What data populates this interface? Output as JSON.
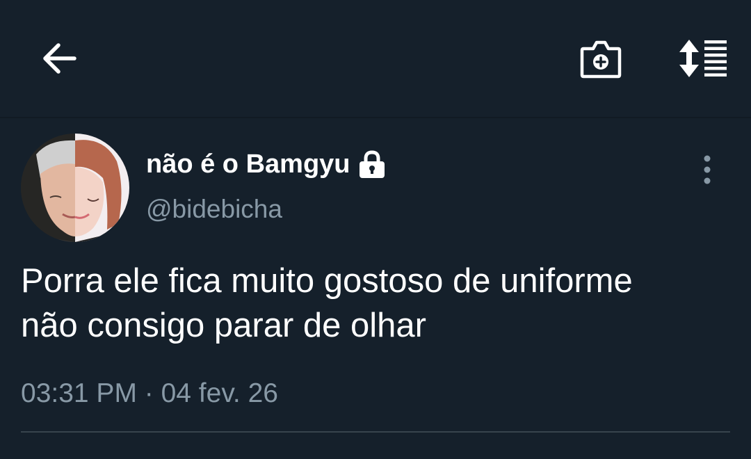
{
  "header": {
    "back_icon": "arrow-left-icon",
    "camera_icon": "camera-plus-icon",
    "sort_icon": "sort-list-icon"
  },
  "tweet": {
    "display_name": "não é o Bamgyu",
    "protected_icon": "lock-icon",
    "handle": "@bidebicha",
    "text_lines": [
      "Porra ele fica muito gostoso de uniforme",
      "não consigo parar de olhar"
    ],
    "timestamp": "03:31 PM · 04 fev. 26",
    "more_icon": "more-vertical-icon"
  },
  "colors": {
    "background": "#15202b",
    "primary_text": "#ffffff",
    "secondary_text": "#8899a6",
    "divider": "#38444d"
  }
}
